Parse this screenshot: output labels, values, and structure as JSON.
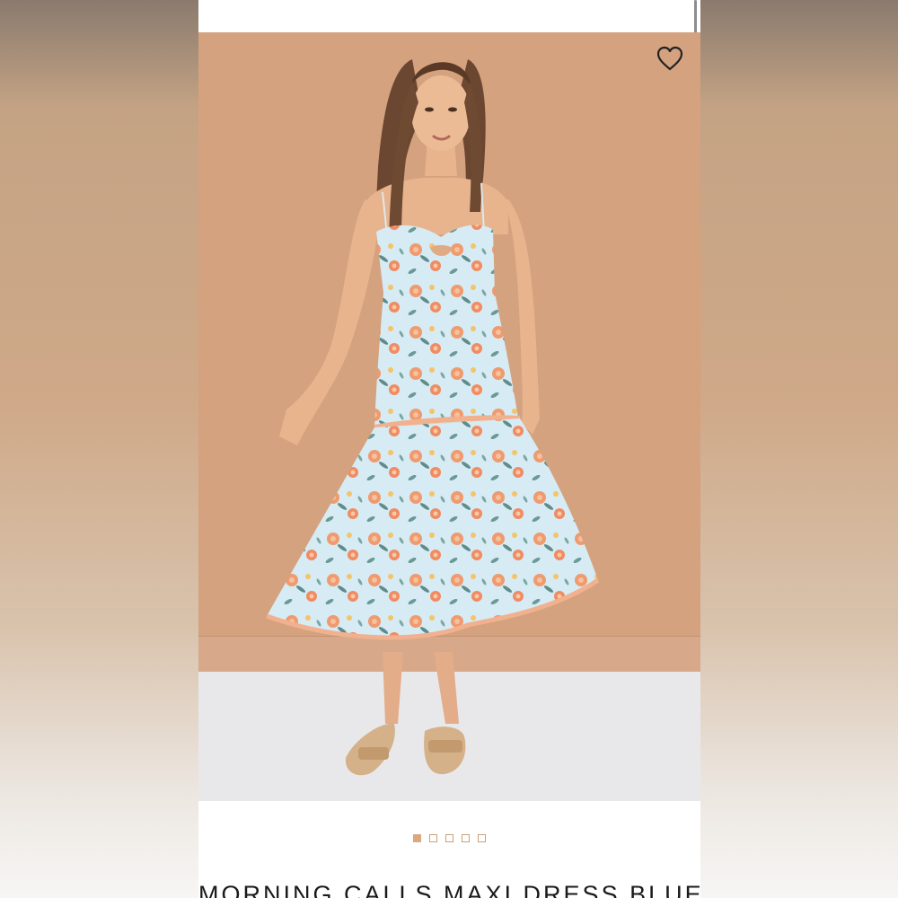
{
  "product": {
    "title": "MORNING CALLS MAXI DRESS BLUE",
    "image_alt": "Model wearing blue floral maxi dress",
    "wishlist_icon": "heart-outline-icon"
  },
  "carousel": {
    "total": 5,
    "active_index": 0
  },
  "colors": {
    "backdrop": "#d4a27f",
    "floor": "#e8e8ea",
    "dot_accent": "#d9a97f",
    "dress_base": "#d6ebf3",
    "flower": "#ef9a6f"
  }
}
